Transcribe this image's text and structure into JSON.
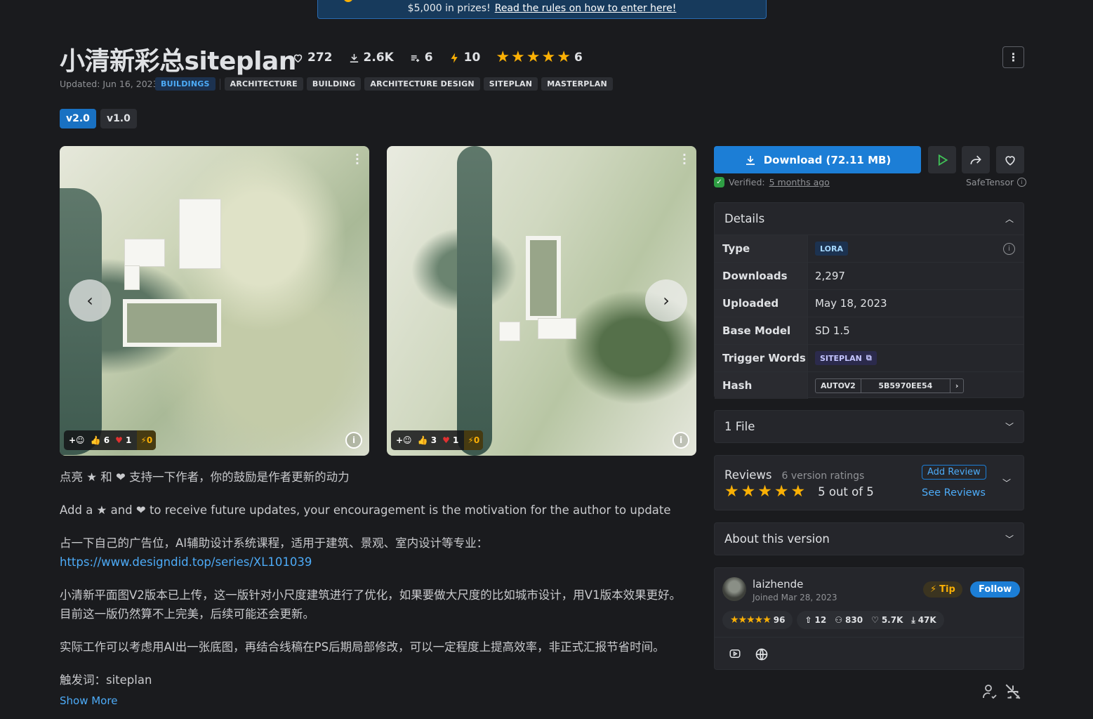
{
  "banner": {
    "text": "$5,000 in prizes!",
    "link": "Read the rules on how to enter here!"
  },
  "model": {
    "title": "小清新彩总siteplan",
    "stats": {
      "likes": "272",
      "downloads": "2.6K",
      "collections": "6",
      "buzz": "10",
      "rating_count": "6"
    },
    "rating": 5,
    "updated": "Updated: Jun 16, 2023",
    "tags": [
      "BUILDINGS",
      "ARCHITECTURE",
      "BUILDING",
      "ARCHITECTURE DESIGN",
      "SITEPLAN",
      "MASTERPLAN"
    ],
    "versions": [
      "v2.0",
      "v1.0"
    ]
  },
  "gallery": [
    {
      "thumbs": "6",
      "hearts": "1",
      "buzz": "0"
    },
    {
      "thumbs": "3",
      "hearts": "1",
      "buzz": "0"
    }
  ],
  "description": {
    "line1": "点亮 ★ 和 ❤ 支持一下作者，你的鼓励是作者更新的动力",
    "line2": "Add a ★ and ❤ to receive future updates, your encouragement is the motivation for the author to update",
    "line3": "占一下自己的广告位，AI辅助设计系统课程，适用于建筑、景观、室内设计等专业：",
    "url": "https://www.designdid.top/series/XL101039",
    "line4": "小清新平面图V2版本已上传，这一版针对小尺度建筑进行了优化，如果要做大尺度的比如城市设计，用V1版本效果更好。目前这一版仍然算不上完美，后续可能还会更新。",
    "line5": "实际工作可以考虑用AI出一张底图，再结合线稿在PS后期局部修改，可以一定程度上提高效率，非正式汇报节省时间。",
    "line6": "触发词：siteplan",
    "show_more": "Show More"
  },
  "sidebar": {
    "download_label": "Download (72.11 MB)",
    "verified_label": "Verified:",
    "verified_time": "5 months ago",
    "safetensor": "SafeTensor",
    "details": {
      "title": "Details",
      "type_label": "Type",
      "type": "LORA",
      "downloads_label": "Downloads",
      "downloads": "2,297",
      "uploaded_label": "Uploaded",
      "uploaded": "May 18, 2023",
      "base_label": "Base Model",
      "base": "SD 1.5",
      "trigger_label": "Trigger Words",
      "trigger": "SITEPLAN",
      "hash_label": "Hash",
      "hash_type": "AUTOV2",
      "hash": "5B5970EE54"
    },
    "files": "1 File",
    "reviews": {
      "title": "Reviews",
      "count": "6 version ratings",
      "score": "5 out of 5",
      "add": "Add Review",
      "see": "See Reviews",
      "rating": 5
    },
    "about": "About this version",
    "creator": {
      "name": "laizhende",
      "joined": "Joined Mar 28, 2023",
      "tip": "Tip",
      "follow": "Follow",
      "rating": "96",
      "uploads": "12",
      "followers": "830",
      "likes": "5.7K",
      "downloads": "47K"
    }
  },
  "colors": {
    "accent": "#1c7ed6",
    "star": "#fab005",
    "bg": "#1a1b1e"
  }
}
